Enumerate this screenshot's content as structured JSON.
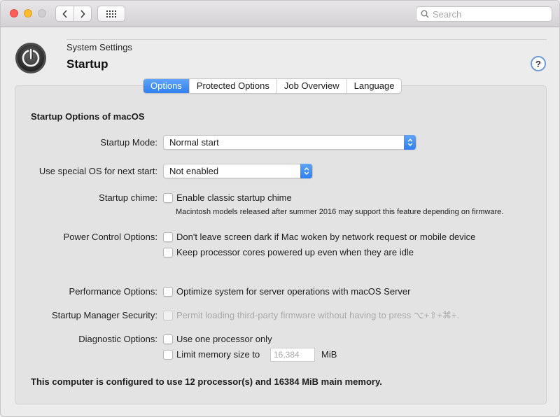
{
  "search": {
    "placeholder": "Search"
  },
  "header": {
    "breadcrumb": "System Settings",
    "title": "Startup",
    "help": "?"
  },
  "tabs": [
    {
      "label": "Options",
      "active": true
    },
    {
      "label": "Protected Options",
      "active": false
    },
    {
      "label": "Job Overview",
      "active": false
    },
    {
      "label": "Language",
      "active": false
    }
  ],
  "section": {
    "title": "Startup Options of macOS"
  },
  "startup_mode": {
    "label": "Startup Mode:",
    "value": "Normal start"
  },
  "special_os": {
    "label": "Use special OS for next start:",
    "value": "Not enabled"
  },
  "chime": {
    "label": "Startup chime:",
    "option": "Enable classic startup chime",
    "note": "Macintosh models released after summer 2016 may support this feature depending on firmware."
  },
  "power": {
    "label": "Power Control Options:",
    "option1": "Don't leave screen dark if Mac woken by network request or mobile device",
    "option2": "Keep processor cores powered up even when they are idle"
  },
  "performance": {
    "label": "Performance Options:",
    "option": "Optimize system for server operations with macOS Server"
  },
  "security": {
    "label": "Startup Manager Security:",
    "option": "Permit loading third-party firmware without having to press ⌥+⇧+⌘+."
  },
  "diagnostic": {
    "label": "Diagnostic Options:",
    "option1": "Use one processor only",
    "option2": "Limit memory size to",
    "memory_value": "16,384",
    "memory_unit": "MiB"
  },
  "footer": "This computer is configured to use 12 processor(s) and 16384 MiB main memory.",
  "colors": {
    "accent": "#2f7ff0",
    "close": "#fc5f57",
    "minimize": "#fdbc2e"
  }
}
